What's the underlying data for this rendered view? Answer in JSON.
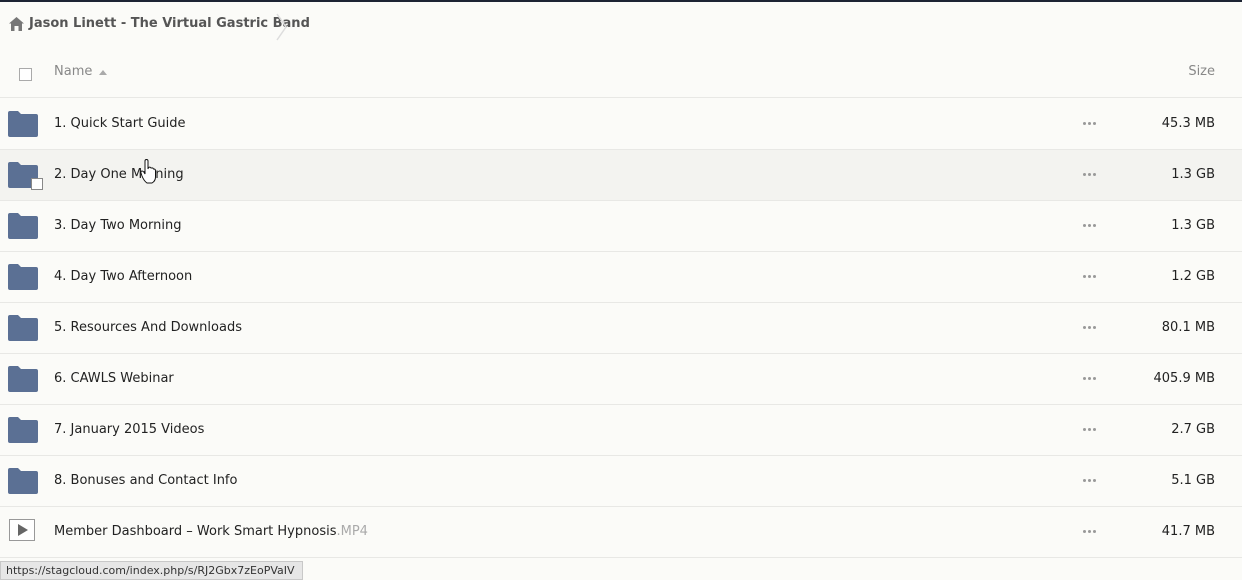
{
  "breadcrumb": {
    "label": "Jason Linett - The Virtual Gastric Band"
  },
  "header": {
    "name_label": "Name",
    "size_label": "Size"
  },
  "files": [
    {
      "name": "1. Quick Start Guide",
      "ext": "",
      "size": "45.3 MB",
      "type": "folder-icon"
    },
    {
      "name": "2. Day One Morning",
      "ext": "",
      "size": "1.3 GB",
      "type": "folder-icon"
    },
    {
      "name": "3. Day Two Morning",
      "ext": "",
      "size": "1.3 GB",
      "type": "folder-icon"
    },
    {
      "name": "4. Day Two Afternoon",
      "ext": "",
      "size": "1.2 GB",
      "type": "folder-icon"
    },
    {
      "name": "5. Resources And Downloads",
      "ext": "",
      "size": "80.1 MB",
      "type": "folder-icon"
    },
    {
      "name": "6. CAWLS Webinar",
      "ext": "",
      "size": "405.9 MB",
      "type": "folder-icon"
    },
    {
      "name": "7. January 2015 Videos",
      "ext": "",
      "size": "2.7 GB",
      "type": "folder-icon"
    },
    {
      "name": "8. Bonuses and Contact Info",
      "ext": "",
      "size": "5.1 GB",
      "type": "folder-icon"
    },
    {
      "name": "Member Dashboard – Work Smart Hypnosis",
      "ext": ".MP4",
      "size": "41.7 MB",
      "type": "video-icon"
    }
  ],
  "status_bar": {
    "url": "https://stagcloud.com/index.php/s/RJ2Gbx7zEoPVaIV"
  },
  "colors": {
    "folder": "#5b7094",
    "background": "#fbfbf8",
    "hover_row": "#f3f3f0"
  }
}
